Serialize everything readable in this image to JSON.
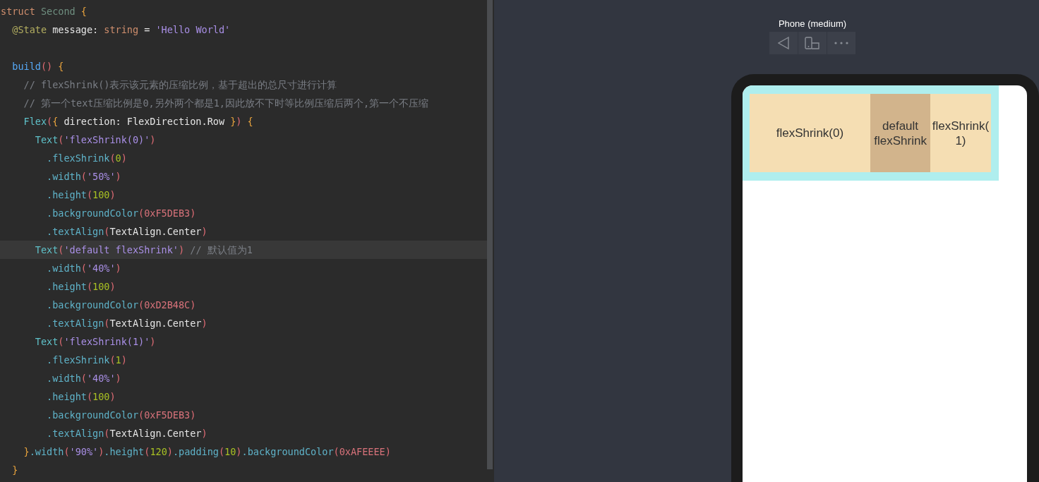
{
  "editor": {
    "lines": [
      {
        "current": false,
        "tokens": [
          {
            "kind": "kw",
            "text": "struct "
          },
          {
            "kind": "type",
            "text": "Second "
          },
          {
            "kind": "brace",
            "text": "{"
          }
        ]
      },
      {
        "current": false,
        "tokens": [
          {
            "kind": "deco",
            "text": "  @State "
          },
          {
            "kind": "ident",
            "text": "message: "
          },
          {
            "kind": "kw",
            "text": "string"
          },
          {
            "kind": "ident",
            "text": " = "
          },
          {
            "kind": "str",
            "text": "'Hello World'"
          }
        ]
      },
      {
        "current": false
      },
      {
        "current": false,
        "tokens": [
          {
            "kind": "fn",
            "text": "  build"
          },
          {
            "kind": "paren",
            "text": "() "
          },
          {
            "kind": "brace",
            "text": "{"
          }
        ]
      },
      {
        "current": false,
        "tokens": [
          {
            "kind": "cmt",
            "text": "    // flexShrink()表示该元素的压缩比例，基于超出的总尺寸进行计算"
          }
        ]
      },
      {
        "current": false,
        "tokens": [
          {
            "kind": "cmt",
            "text": "    // 第一个text压缩比例是0,另外两个都是1,因此放不下时等比例压缩后两个,第一个不压缩"
          }
        ]
      },
      {
        "current": false,
        "tokens": [
          {
            "kind": "comp",
            "text": "    Flex"
          },
          {
            "kind": "paren",
            "text": "("
          },
          {
            "kind": "brace",
            "text": "{ "
          },
          {
            "kind": "ident",
            "text": "direction: FlexDirection.Row "
          },
          {
            "kind": "brace",
            "text": "}"
          },
          {
            "kind": "paren",
            "text": ") "
          },
          {
            "kind": "brace",
            "text": "{"
          }
        ]
      },
      {
        "current": false,
        "tokens": [
          {
            "kind": "comp",
            "text": "      Text"
          },
          {
            "kind": "paren",
            "text": "("
          },
          {
            "kind": "str",
            "text": "'flexShrink(0)'"
          },
          {
            "kind": "paren",
            "text": ")"
          }
        ]
      },
      {
        "current": false,
        "tokens": [
          {
            "kind": "method",
            "text": "        .flexShrink"
          },
          {
            "kind": "paren",
            "text": "("
          },
          {
            "kind": "num",
            "text": "0"
          },
          {
            "kind": "paren",
            "text": ")"
          }
        ]
      },
      {
        "current": false,
        "tokens": [
          {
            "kind": "method",
            "text": "        .width"
          },
          {
            "kind": "paren",
            "text": "("
          },
          {
            "kind": "str",
            "text": "'50%'"
          },
          {
            "kind": "paren",
            "text": ")"
          }
        ]
      },
      {
        "current": false,
        "tokens": [
          {
            "kind": "method",
            "text": "        .height"
          },
          {
            "kind": "paren",
            "text": "("
          },
          {
            "kind": "num",
            "text": "100"
          },
          {
            "kind": "paren",
            "text": ")"
          }
        ]
      },
      {
        "current": false,
        "tokens": [
          {
            "kind": "method",
            "text": "        .backgroundColor"
          },
          {
            "kind": "paren",
            "text": "("
          },
          {
            "kind": "hex",
            "text": "0xF5DEB3"
          },
          {
            "kind": "paren",
            "text": ")"
          }
        ]
      },
      {
        "current": false,
        "tokens": [
          {
            "kind": "method",
            "text": "        .textAlign"
          },
          {
            "kind": "paren",
            "text": "("
          },
          {
            "kind": "ident",
            "text": "TextAlign.Center"
          },
          {
            "kind": "paren",
            "text": ")"
          }
        ]
      },
      {
        "current": true,
        "tokens": [
          {
            "kind": "comp",
            "text": "      Text"
          },
          {
            "kind": "paren",
            "text": "("
          },
          {
            "kind": "str",
            "text": "'default flexShrink'"
          },
          {
            "kind": "paren",
            "text": ") "
          },
          {
            "kind": "cmt",
            "text": "// 默认值为1"
          }
        ]
      },
      {
        "current": false,
        "tokens": [
          {
            "kind": "method",
            "text": "        .width"
          },
          {
            "kind": "paren",
            "text": "("
          },
          {
            "kind": "str",
            "text": "'40%'"
          },
          {
            "kind": "paren",
            "text": ")"
          }
        ]
      },
      {
        "current": false,
        "tokens": [
          {
            "kind": "method",
            "text": "        .height"
          },
          {
            "kind": "paren",
            "text": "("
          },
          {
            "kind": "num",
            "text": "100"
          },
          {
            "kind": "paren",
            "text": ")"
          }
        ]
      },
      {
        "current": false,
        "tokens": [
          {
            "kind": "method",
            "text": "        .backgroundColor"
          },
          {
            "kind": "paren",
            "text": "("
          },
          {
            "kind": "hex",
            "text": "0xD2B48C"
          },
          {
            "kind": "paren",
            "text": ")"
          }
        ]
      },
      {
        "current": false,
        "tokens": [
          {
            "kind": "method",
            "text": "        .textAlign"
          },
          {
            "kind": "paren",
            "text": "("
          },
          {
            "kind": "ident",
            "text": "TextAlign.Center"
          },
          {
            "kind": "paren",
            "text": ")"
          }
        ]
      },
      {
        "current": false,
        "tokens": [
          {
            "kind": "comp",
            "text": "      Text"
          },
          {
            "kind": "paren",
            "text": "("
          },
          {
            "kind": "str",
            "text": "'flexShrink(1)'"
          },
          {
            "kind": "paren",
            "text": ")"
          }
        ]
      },
      {
        "current": false,
        "tokens": [
          {
            "kind": "method",
            "text": "        .flexShrink"
          },
          {
            "kind": "paren",
            "text": "("
          },
          {
            "kind": "num",
            "text": "1"
          },
          {
            "kind": "paren",
            "text": ")"
          }
        ]
      },
      {
        "current": false,
        "tokens": [
          {
            "kind": "method",
            "text": "        .width"
          },
          {
            "kind": "paren",
            "text": "("
          },
          {
            "kind": "str",
            "text": "'40%'"
          },
          {
            "kind": "paren",
            "text": ")"
          }
        ]
      },
      {
        "current": false,
        "tokens": [
          {
            "kind": "method",
            "text": "        .height"
          },
          {
            "kind": "paren",
            "text": "("
          },
          {
            "kind": "num",
            "text": "100"
          },
          {
            "kind": "paren",
            "text": ")"
          }
        ]
      },
      {
        "current": false,
        "tokens": [
          {
            "kind": "method",
            "text": "        .backgroundColor"
          },
          {
            "kind": "paren",
            "text": "("
          },
          {
            "kind": "hex",
            "text": "0xF5DEB3"
          },
          {
            "kind": "paren",
            "text": ")"
          }
        ]
      },
      {
        "current": false,
        "tokens": [
          {
            "kind": "method",
            "text": "        .textAlign"
          },
          {
            "kind": "paren",
            "text": "("
          },
          {
            "kind": "ident",
            "text": "TextAlign.Center"
          },
          {
            "kind": "paren",
            "text": ")"
          }
        ]
      },
      {
        "current": false,
        "tokens": [
          {
            "kind": "brace",
            "text": "    }"
          },
          {
            "kind": "method",
            "text": ".width"
          },
          {
            "kind": "paren",
            "text": "("
          },
          {
            "kind": "str",
            "text": "'90%'"
          },
          {
            "kind": "paren",
            "text": ")"
          },
          {
            "kind": "method",
            "text": ".height"
          },
          {
            "kind": "paren",
            "text": "("
          },
          {
            "kind": "num",
            "text": "120"
          },
          {
            "kind": "paren",
            "text": ")"
          },
          {
            "kind": "method",
            "text": ".padding"
          },
          {
            "kind": "paren",
            "text": "("
          },
          {
            "kind": "num",
            "text": "10"
          },
          {
            "kind": "paren",
            "text": ")"
          },
          {
            "kind": "method",
            "text": ".backgroundColor"
          },
          {
            "kind": "paren",
            "text": "("
          },
          {
            "kind": "hex",
            "text": "0xAFEEEE"
          },
          {
            "kind": "paren",
            "text": ")"
          }
        ]
      },
      {
        "current": false,
        "tokens": [
          {
            "kind": "brace",
            "text": "  }"
          }
        ]
      }
    ]
  },
  "preview": {
    "device": "Phone (medium)",
    "container": {
      "color": "#afeeee",
      "items": [
        {
          "text": "flexShrink(0)",
          "color": "#f5deb3",
          "shrink": false
        },
        {
          "text": "default flexShrink",
          "color": "#d2b48c",
          "shrink": true
        },
        {
          "text": "flexShrink(1)",
          "color": "#f5deb3",
          "shrink": true
        }
      ]
    }
  }
}
